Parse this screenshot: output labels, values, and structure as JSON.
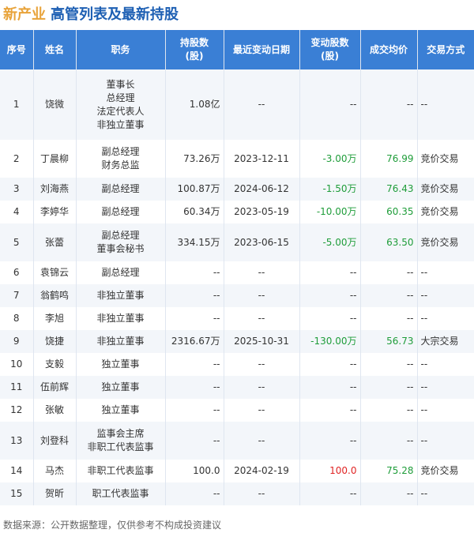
{
  "title": {
    "company": "新产业",
    "subtitle": "高管列表及最新持股"
  },
  "headers": {
    "seq": "序号",
    "name": "姓名",
    "position": "职务",
    "shares_line1": "持股数",
    "shares_line2": "(股)",
    "date": "最近变动日期",
    "change_line1": "变动股数",
    "change_line2": "(股)",
    "price": "成交均价",
    "method": "交易方式"
  },
  "rows": [
    {
      "seq": "1",
      "name": "饶微",
      "positions": [
        "董事长",
        "总经理",
        "法定代表人",
        "非独立董事"
      ],
      "shares": "1.08亿",
      "date": "--",
      "change": "--",
      "change_sign": "none",
      "price": "--",
      "method": "--"
    },
    {
      "seq": "2",
      "name": "丁晨柳",
      "positions": [
        "副总经理",
        "财务总监"
      ],
      "shares": "73.26万",
      "date": "2023-12-11",
      "change": "-3.00万",
      "change_sign": "neg",
      "price": "76.99",
      "method": "竞价交易"
    },
    {
      "seq": "3",
      "name": "刘海燕",
      "positions": [
        "副总经理"
      ],
      "shares": "100.87万",
      "date": "2024-06-12",
      "change": "-1.50万",
      "change_sign": "neg",
      "price": "76.43",
      "method": "竞价交易"
    },
    {
      "seq": "4",
      "name": "李婷华",
      "positions": [
        "副总经理"
      ],
      "shares": "60.34万",
      "date": "2023-05-19",
      "change": "-10.00万",
      "change_sign": "neg",
      "price": "60.35",
      "method": "竞价交易"
    },
    {
      "seq": "5",
      "name": "张蕾",
      "positions": [
        "副总经理",
        "董事会秘书"
      ],
      "shares": "334.15万",
      "date": "2023-06-15",
      "change": "-5.00万",
      "change_sign": "neg",
      "price": "63.50",
      "method": "竞价交易"
    },
    {
      "seq": "6",
      "name": "袁锦云",
      "positions": [
        "副总经理"
      ],
      "shares": "--",
      "date": "--",
      "change": "--",
      "change_sign": "none",
      "price": "--",
      "method": "--"
    },
    {
      "seq": "7",
      "name": "翁鹤鸣",
      "positions": [
        "非独立董事"
      ],
      "shares": "--",
      "date": "--",
      "change": "--",
      "change_sign": "none",
      "price": "--",
      "method": "--"
    },
    {
      "seq": "8",
      "name": "李旭",
      "positions": [
        "非独立董事"
      ],
      "shares": "--",
      "date": "--",
      "change": "--",
      "change_sign": "none",
      "price": "--",
      "method": "--"
    },
    {
      "seq": "9",
      "name": "饶捷",
      "positions": [
        "非独立董事"
      ],
      "shares": "2316.67万",
      "date": "2025-10-31",
      "change": "-130.00万",
      "change_sign": "neg",
      "price": "56.73",
      "method": "大宗交易"
    },
    {
      "seq": "10",
      "name": "支毅",
      "positions": [
        "独立董事"
      ],
      "shares": "--",
      "date": "--",
      "change": "--",
      "change_sign": "none",
      "price": "--",
      "method": "--"
    },
    {
      "seq": "11",
      "name": "伍前辉",
      "positions": [
        "独立董事"
      ],
      "shares": "--",
      "date": "--",
      "change": "--",
      "change_sign": "none",
      "price": "--",
      "method": "--"
    },
    {
      "seq": "12",
      "name": "张敏",
      "positions": [
        "独立董事"
      ],
      "shares": "--",
      "date": "--",
      "change": "--",
      "change_sign": "none",
      "price": "--",
      "method": "--"
    },
    {
      "seq": "13",
      "name": "刘登科",
      "positions": [
        "监事会主席",
        "非职工代表监事"
      ],
      "shares": "--",
      "date": "--",
      "change": "--",
      "change_sign": "none",
      "price": "--",
      "method": "--"
    },
    {
      "seq": "14",
      "name": "马杰",
      "positions": [
        "非职工代表监事"
      ],
      "shares": "100.0",
      "date": "2024-02-19",
      "change": "100.0",
      "change_sign": "pos",
      "price": "75.28",
      "method": "竞价交易"
    },
    {
      "seq": "15",
      "name": "贺昕",
      "positions": [
        "职工代表监事"
      ],
      "shares": "--",
      "date": "--",
      "change": "--",
      "change_sign": "none",
      "price": "--",
      "method": "--"
    }
  ],
  "colors": {
    "company": "#e8a33a",
    "subtitle": "#1d5fb3",
    "header_bg": "#3a7fd5",
    "negative": "#1f9d3a",
    "positive": "#e02424"
  },
  "footer": "数据来源：公开数据整理，仅供参考不构成投资建议"
}
